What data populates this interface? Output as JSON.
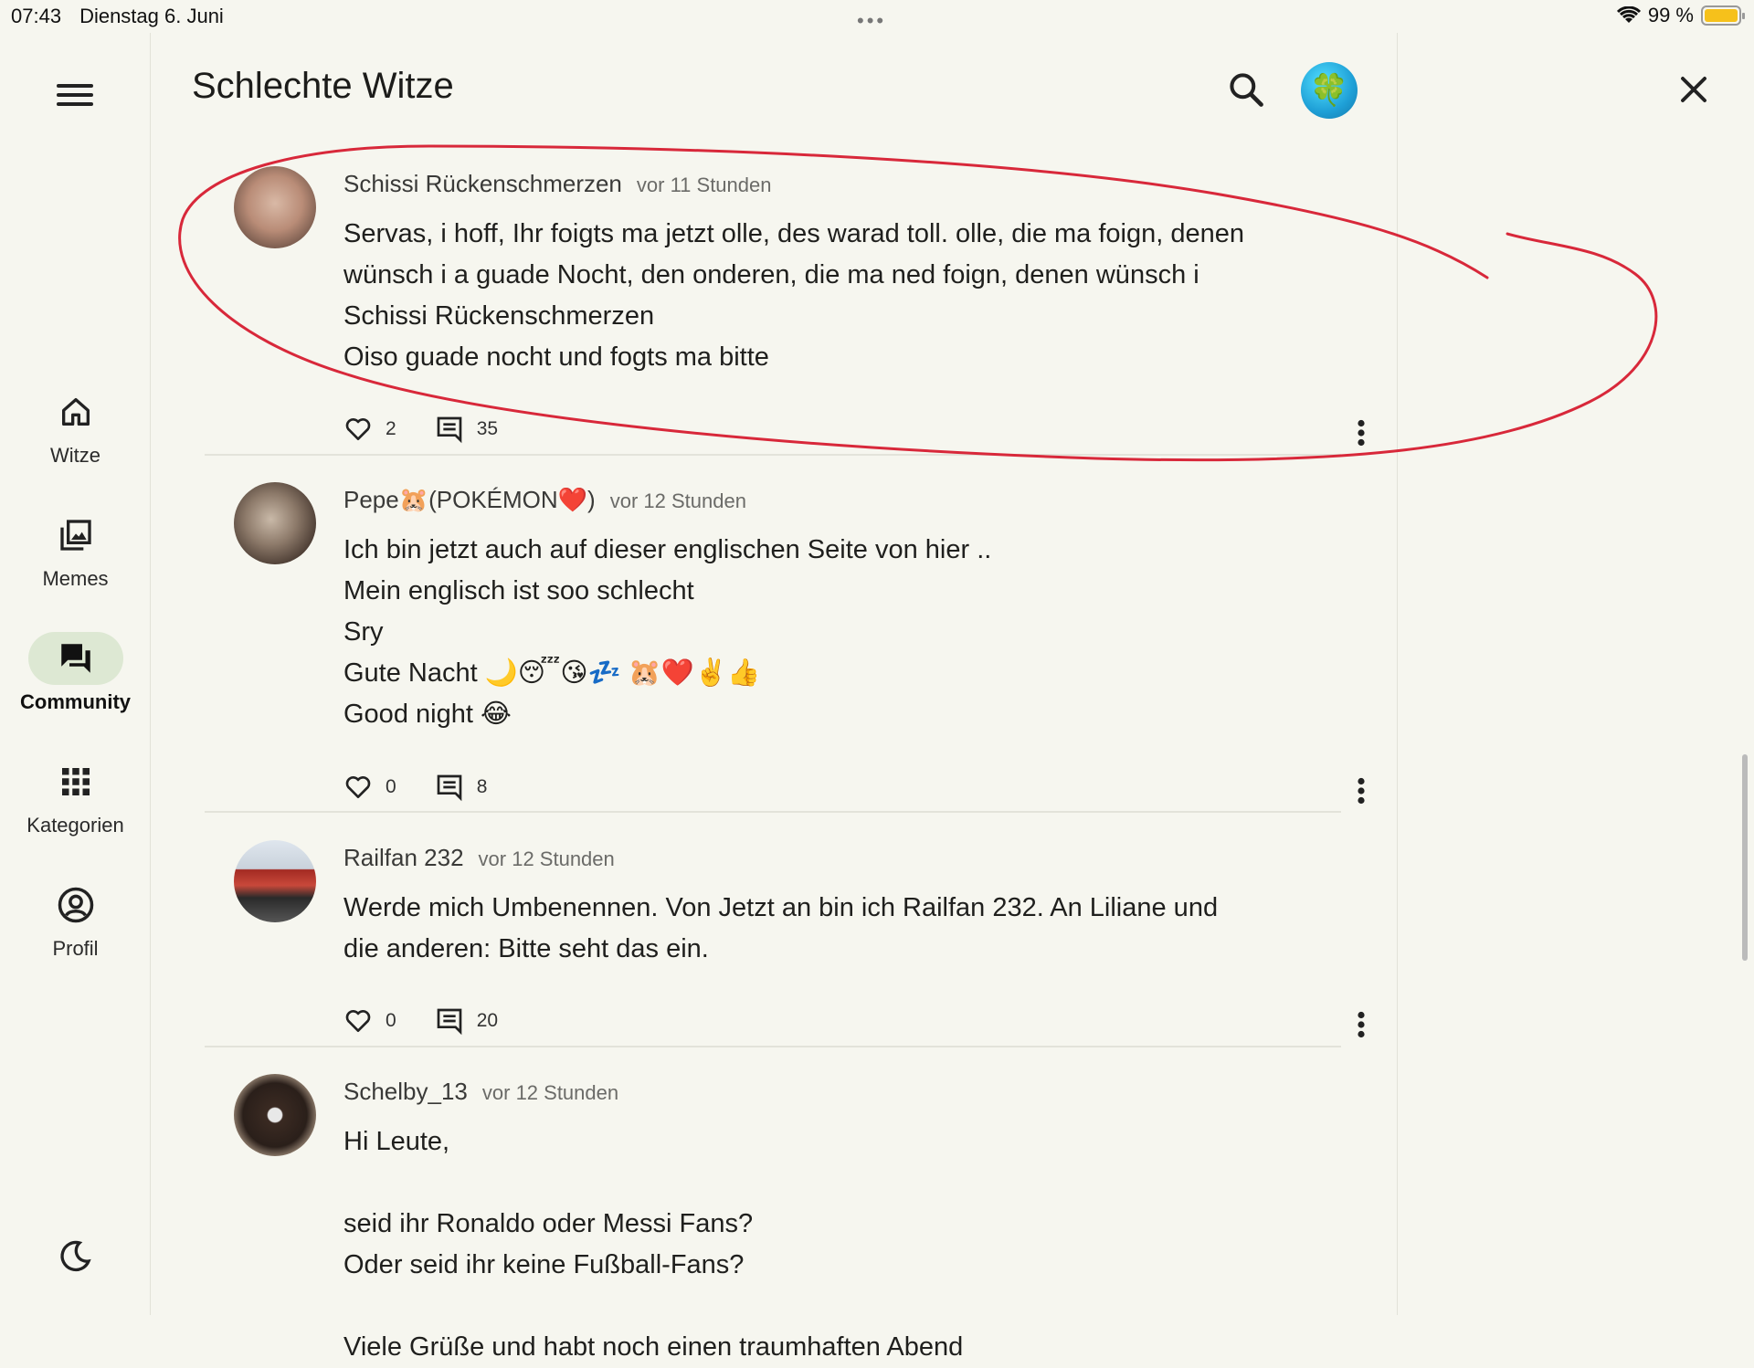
{
  "status": {
    "time": "07:43",
    "date": "Dienstag 6. Juni",
    "battery": "99 %",
    "dots": "•••",
    "wifi_icon": "wifi-icon",
    "battery_level": 0.99
  },
  "rail": {
    "items": [
      {
        "label": "Witze",
        "icon": "home-icon"
      },
      {
        "label": "Memes",
        "icon": "image-library-icon"
      },
      {
        "label": "Community",
        "icon": "forum-icon"
      },
      {
        "label": "Kategorien",
        "icon": "apps-grid-icon"
      },
      {
        "label": "Profil",
        "icon": "account-circle-icon"
      }
    ],
    "active": "Community"
  },
  "header": {
    "title": "Schlechte Witze",
    "avatar_glyph": "🍀"
  },
  "posts": [
    {
      "author": "Schissi Rückenschmerzen",
      "time": "vor 11 Stunden",
      "text": "Servas, i hoff, Ihr foigts ma jetzt olle, des warad toll. olle, die ma foign, denen\nwünsch i a guade Nocht, den onderen, die ma ned foign, denen wünsch i\nSchissi Rückenschmerzen\nOiso guade nocht und fogts ma bitte",
      "likes": "2",
      "comments": "35"
    },
    {
      "author": "Pepe🐹(POKÉMON❤️)",
      "time": "vor 12 Stunden",
      "text": "Ich bin jetzt auch auf dieser englischen Seite von hier ..\nMein englisch ist soo schlecht\nSry\nGute Nacht 🌙😴😘💤 🐹❤️✌️👍\nGood night 😂",
      "likes": "0",
      "comments": "8"
    },
    {
      "author": "Railfan 232",
      "time": "vor 12 Stunden",
      "text": "Werde mich Umbenennen. Von Jetzt an bin ich Railfan 232. An Liliane und\ndie anderen: Bitte seht das ein.",
      "likes": "0",
      "comments": "20"
    },
    {
      "author": "Schelby_13",
      "time": "vor 12 Stunden",
      "text": "Hi Leute,\n\nseid ihr Ronaldo oder Messi Fans?\nOder seid ihr keine Fußball-Fans?\n\nViele Grüße und habt noch einen traumhaften Abend",
      "likes": "",
      "comments": ""
    }
  ],
  "colors": {
    "background": "#f6f6ef",
    "active_pill": "#dde8d3",
    "annotation": "#d8283a"
  }
}
